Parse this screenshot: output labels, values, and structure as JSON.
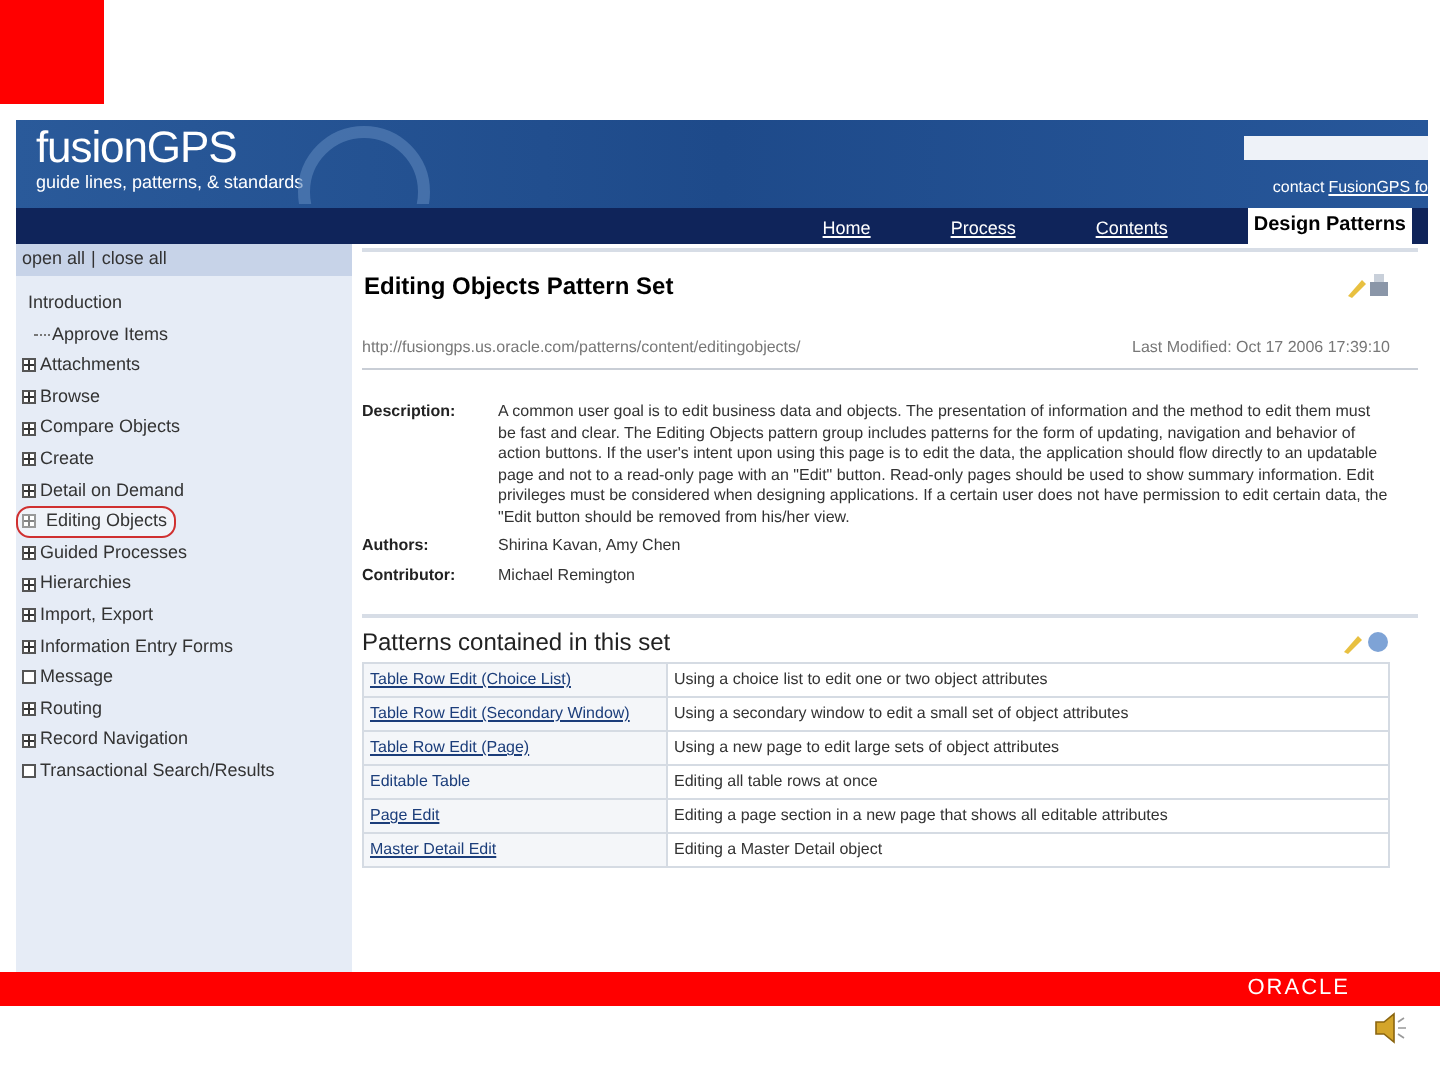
{
  "header": {
    "logo": "fusionGPS",
    "tagline": "guide lines, patterns, & standards",
    "contact_prefix": "contact",
    "contact_link": "FusionGPS fo"
  },
  "nav": [
    {
      "label": "Home",
      "selected": false
    },
    {
      "label": "Process",
      "selected": false
    },
    {
      "label": "Contents",
      "selected": false
    },
    {
      "label": "Design Patterns",
      "selected": true
    }
  ],
  "sidebar": {
    "toggle_open": "open all",
    "separator": "|",
    "toggle_close": "close all",
    "tree": [
      {
        "label": "Introduction",
        "expandable": false,
        "highlighted": false,
        "children": [
          {
            "label": "Approve Items",
            "expandable": false,
            "highlighted": false
          }
        ]
      },
      {
        "label": "Attachments",
        "expandable": true,
        "highlighted": false
      },
      {
        "label": "Browse",
        "expandable": true,
        "highlighted": false
      },
      {
        "label": "Compare Objects",
        "expandable": true,
        "highlighted": false
      },
      {
        "label": "Create",
        "expandable": true,
        "highlighted": false
      },
      {
        "label": "Detail on Demand",
        "expandable": true,
        "highlighted": false
      },
      {
        "label": "Editing Objects",
        "expandable": true,
        "highlighted": true
      },
      {
        "label": "Guided Processes",
        "expandable": true,
        "highlighted": false
      },
      {
        "label": "Hierarchies",
        "expandable": true,
        "highlighted": false
      },
      {
        "label": "Import, Export",
        "expandable": true,
        "highlighted": false
      },
      {
        "label": "Information Entry Forms",
        "expandable": true,
        "highlighted": false
      },
      {
        "label": "Message",
        "expandable": false,
        "highlighted": false
      },
      {
        "label": "Routing",
        "expandable": true,
        "highlighted": false
      },
      {
        "label": "Record Navigation",
        "expandable": true,
        "highlighted": false
      },
      {
        "label": "Transactional Search/Results",
        "expandable": false,
        "highlighted": false
      }
    ]
  },
  "content": {
    "title": "Editing Objects Pattern Set",
    "url": "http://fusiongps.us.oracle.com/patterns/content/editingobjects/",
    "last_modified": "Last Modified: Oct 17 2006 17:39:10",
    "fields": [
      {
        "label": "Description:",
        "value": "A common user goal is to edit business data and objects. The presentation of information and the method to edit them must be fast and clear. The Editing Objects pattern group includes patterns for the form of updating, navigation and behavior of action buttons. If the user's intent upon using this page is to edit the data, the application should flow directly to an updatable page and not to a read-only page with an \"Edit\" button. Read-only pages should be used to show summary information. Edit privileges must be considered when designing applications. If a certain user does not have permission to edit certain data, the \"Edit button should be removed from his/her view."
      },
      {
        "label": "Authors:",
        "value": "Shirina Kavan, Amy Chen"
      },
      {
        "label": "Contributor:",
        "value": "Michael Remington"
      }
    ],
    "patterns_title": "Patterns contained in this set",
    "patterns": [
      {
        "name": "Table Row Edit (Choice List)",
        "link": true,
        "description": "Using a choice list to edit one or two object attributes"
      },
      {
        "name": "Table Row Edit (Secondary Window)",
        "link": true,
        "description": "Using a secondary window to edit a small set of object attributes"
      },
      {
        "name": "Table Row Edit (Page)",
        "link": true,
        "description": "Using a new page to edit large sets of object attributes"
      },
      {
        "name": "Editable Table",
        "link": false,
        "description": "Editing all table rows at once"
      },
      {
        "name": "Page Edit",
        "link": true,
        "description": "Editing a page section in a new page that shows all editable attributes"
      },
      {
        "name": "Master Detail Edit",
        "link": true,
        "description": "Editing a Master Detail object"
      }
    ]
  },
  "footer": {
    "brand": "ORACLE"
  }
}
